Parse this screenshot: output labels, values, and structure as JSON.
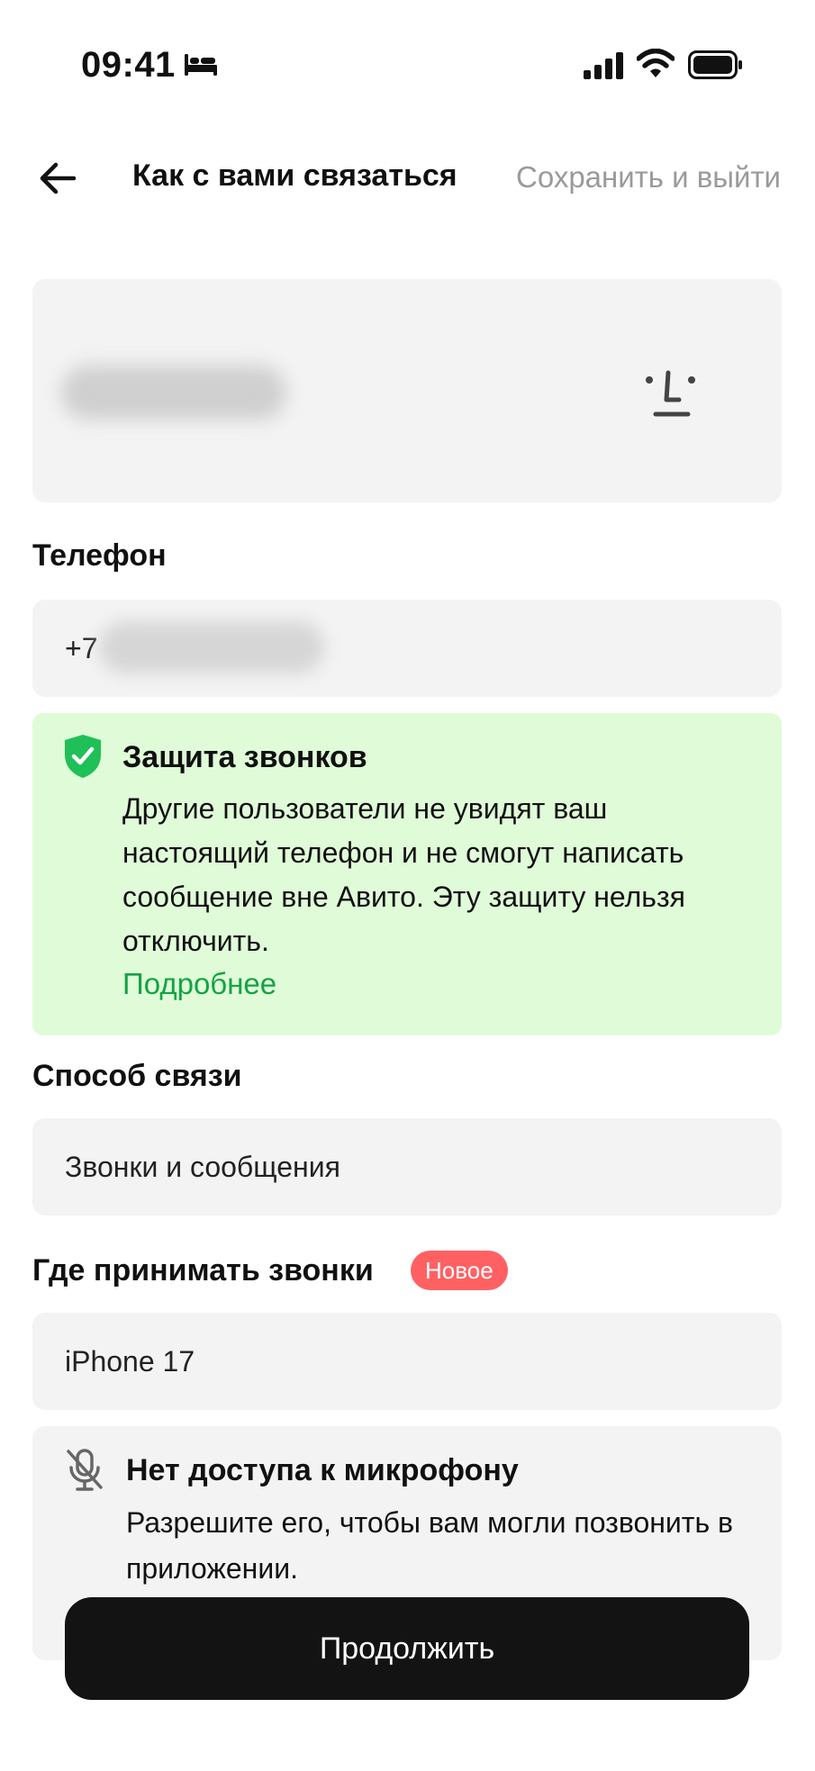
{
  "status_bar": {
    "time": "09:41",
    "icons": [
      "bed-icon",
      "signal-icon",
      "wifi-icon",
      "battery-icon"
    ]
  },
  "header": {
    "back_icon": "arrow-left-icon",
    "title": "Как с вами связаться",
    "save_exit_label": "Сохранить и выйти"
  },
  "phone_section": {
    "label": "Телефон",
    "prefix": "+7"
  },
  "protection": {
    "title": "Защита звонков",
    "body": "Другие пользователи не увидят ваш настоящий телефон и не смогут написать сообщение вне Авито. Эту защиту нельзя отключить.",
    "link": "Подробнее",
    "icon": "shield-check-icon",
    "accent": "#13a346",
    "background": "#e0fbd8"
  },
  "contact_method": {
    "label": "Способ связи",
    "value": "Звонки и сообщения"
  },
  "calls": {
    "label": "Где принимать звонки",
    "badge": "Новое",
    "badge_color": "#ff6163",
    "value": "iPhone 17"
  },
  "microphone": {
    "icon": "mic-off-icon",
    "title": "Нет доступа к микрофону",
    "body": "Разрешите его, чтобы вам могли позвонить в приложении."
  },
  "footer": {
    "continue_label": "Продолжить"
  }
}
